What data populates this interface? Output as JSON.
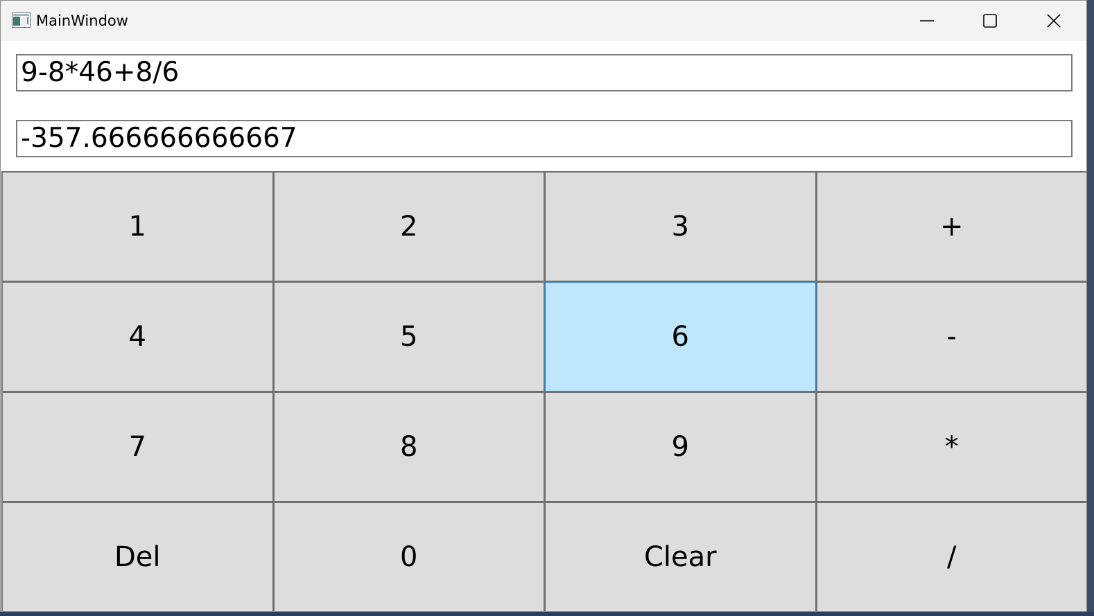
{
  "window": {
    "title": "MainWindow",
    "icon": "app-window-icon"
  },
  "caption_buttons": {
    "minimize_icon": "minimize-icon",
    "maximize_icon": "maximize-icon",
    "close_icon": "close-icon"
  },
  "expression": {
    "value": "9-8*46+8/6"
  },
  "result": {
    "value": "-357.666666666667"
  },
  "keypad": {
    "keys": [
      {
        "label": "1"
      },
      {
        "label": "2"
      },
      {
        "label": "3"
      },
      {
        "label": "+"
      },
      {
        "label": "4"
      },
      {
        "label": "5"
      },
      {
        "label": "6"
      },
      {
        "label": "-"
      },
      {
        "label": "7"
      },
      {
        "label": "8"
      },
      {
        "label": "9"
      },
      {
        "label": "*"
      },
      {
        "label": "Del"
      },
      {
        "label": "0"
      },
      {
        "label": "Clear"
      },
      {
        "label": "/"
      }
    ],
    "hovered_key": "6"
  },
  "colors": {
    "key_background": "#dddddd",
    "key_hover_background": "#bee6fd",
    "key_hover_border": "#3c7fb1",
    "key_border": "#707070",
    "titlebar": "#f3f3f3"
  }
}
